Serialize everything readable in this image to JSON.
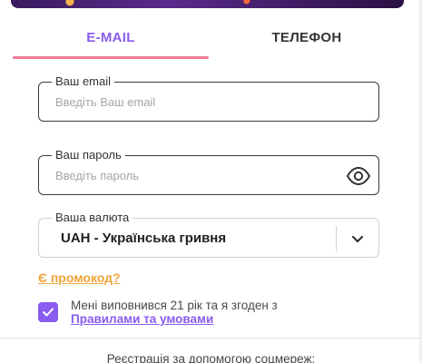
{
  "tabs": [
    {
      "label": "E-MAIL",
      "active": true
    },
    {
      "label": "ТЕЛЕФОН",
      "active": false
    }
  ],
  "colors": {
    "accent": "#8a5cf0",
    "underline": "#f07a9a",
    "promo": "#f0a43a"
  },
  "form": {
    "email": {
      "label": "Ваш email",
      "placeholder": "Введіть Ваш email",
      "value": ""
    },
    "password": {
      "label": "Ваш пароль",
      "placeholder": "Введіть пароль",
      "value": "",
      "icon": "eye-icon"
    },
    "currency": {
      "label": "Ваша валюта",
      "value": "UAH - Українська гривня",
      "icon": "chevron-down-icon"
    }
  },
  "promo_link": "Є промокод?",
  "agreement": {
    "checked": true,
    "text": "Мені виповнився 21 рік та я згоден з",
    "link": "Правилами та умовами"
  },
  "social": {
    "title": "Реєстрація за допомогою соцмереж:"
  }
}
